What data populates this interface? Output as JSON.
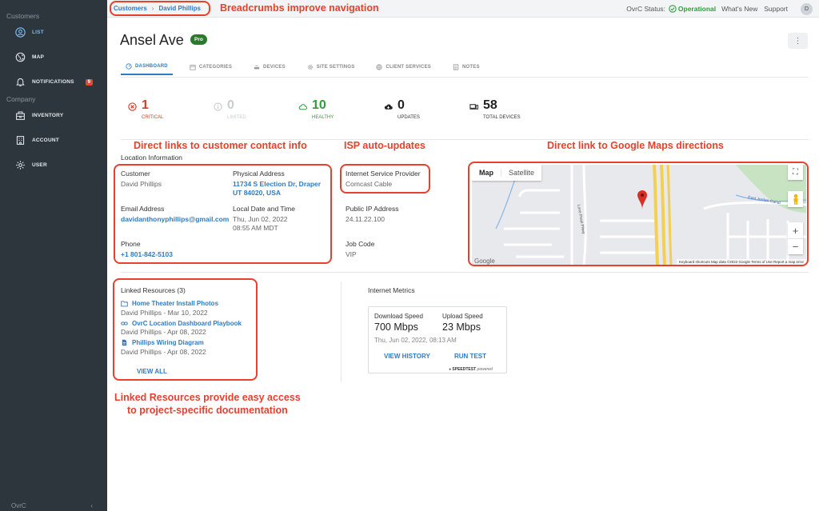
{
  "sidebar": {
    "section_customers": "Customers",
    "section_company": "Company",
    "items": [
      {
        "label": "LIST"
      },
      {
        "label": "MAP"
      },
      {
        "label": "NOTIFICATIONS",
        "badge": "9"
      },
      {
        "label": "INVENTORY"
      },
      {
        "label": "ACCOUNT"
      },
      {
        "label": "USER"
      }
    ],
    "footer": "OvrC"
  },
  "topbar": {
    "breadcrumb": [
      "Customers",
      "David Phillips"
    ],
    "status_label": "OvrC Status:",
    "status_value": "Operational",
    "whats_new": "What's New",
    "support": "Support",
    "avatar": "D"
  },
  "annotations": {
    "breadcrumbs": "Breadcrumbs improve navigation",
    "contact": "Direct links to customer contact info",
    "isp": "ISP auto-updates",
    "maps": "Direct link to Google Maps directions",
    "resources_line1": "Linked Resources provide easy access",
    "resources_line2": "to project-specific documentation"
  },
  "site": {
    "title": "Ansel Ave",
    "badge": "Pro"
  },
  "tabs": [
    {
      "label": "DASHBOARD",
      "active": true
    },
    {
      "label": "CATEGORIES"
    },
    {
      "label": "DEVICES"
    },
    {
      "label": "SITE SETTINGS"
    },
    {
      "label": "CLIENT SERVICES"
    },
    {
      "label": "NOTES"
    }
  ],
  "stats": [
    {
      "value": "1",
      "label": "CRITICAL",
      "color": "#d0402a"
    },
    {
      "value": "0",
      "label": "LIMITED",
      "color": "#c8cdd1"
    },
    {
      "value": "10",
      "label": "HEALTHY",
      "color": "#2e9e3a"
    },
    {
      "value": "0",
      "label": "UPDATES",
      "color": "#222222"
    },
    {
      "value": "58",
      "label": "TOTAL DEVICES",
      "color": "#222222"
    }
  ],
  "location": {
    "section_title": "Location Information",
    "customer_label": "Customer",
    "customer_value": "David Phillips",
    "address_label": "Physical Address",
    "address_line1": "11734 S Election Dr, Draper",
    "address_line2": "UT 84020, USA",
    "email_label": "Email Address",
    "email_value": "davidanthonyphillips@gmail.com",
    "datetime_label": "Local Date and Time",
    "date_value": "Thu, Jun 02, 2022",
    "time_value": "08:55 AM MDT",
    "phone_label": "Phone",
    "phone_value": "+1 801-842-5103",
    "isp_label": "Internet Service Provider",
    "isp_value": "Comcast Cable",
    "ip_label": "Public IP Address",
    "ip_value": "24.11.22.100",
    "jobcode_label": "Job Code",
    "jobcode_value": "VIP"
  },
  "map": {
    "tab_map": "Map",
    "tab_satellite": "Satellite",
    "street_1": "Lone Peak Pkwy",
    "street_2": "East Jordan Canal",
    "brand": "Google",
    "footer": "Keyboard shortcuts   Map data ©2022 Google   Terms of Use   Report a map error"
  },
  "resources": {
    "title": "Linked Resources (3)",
    "items": [
      {
        "name": "Home Theater Install Photos",
        "meta": "David Phillips - Mar 10, 2022",
        "icon": "folder-icon"
      },
      {
        "name": "OvrC Location Dashboard Playbook",
        "meta": "David Phillips - Apr 08, 2022",
        "icon": "link-icon"
      },
      {
        "name": "Phillips Wiring Diagram",
        "meta": "David Phillips - Apr 08, 2022",
        "icon": "document-icon"
      }
    ],
    "view_all": "VIEW ALL"
  },
  "metrics": {
    "title": "Internet Metrics",
    "download_label": "Download Speed",
    "download_value": "700 Mbps",
    "upload_label": "Upload Speed",
    "upload_value": "23 Mbps",
    "timestamp": "Thu, Jun 02, 2022, 08:13 AM",
    "view_history": "VIEW HISTORY",
    "run_test": "RUN TEST",
    "brand": "SPEEDTEST",
    "brand_suffix": "powered"
  },
  "colors": {
    "accent": "#2f7bc4",
    "annotation": "#e8402c",
    "sidebar": "#2d363d"
  }
}
